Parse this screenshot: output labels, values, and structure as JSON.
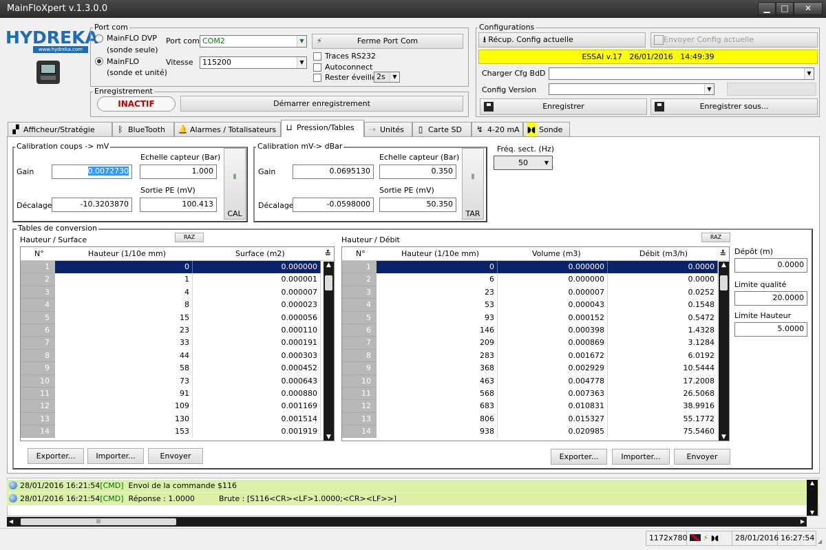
{
  "app": {
    "title": "MainFloXpert v.1.3.0.0"
  },
  "logo": {
    "brand": "HYDREKA",
    "url": "www.hydreka.com"
  },
  "portcom": {
    "legend": "Port com",
    "radio1_l1": "MainFLO DVP",
    "radio1_l2": "(sonde seule)",
    "radio2_l1": "MainFLO",
    "radio2_l2": "(sonde et unité)",
    "port_label": "Port com",
    "port_value": "COM2",
    "speed_label": "Vitesse",
    "speed_value": "115200",
    "close_btn": "Ferme Port Com",
    "traces": "Traces RS232",
    "autoconnect": "Autoconnect",
    "awake": "Rester éveillé",
    "awake_value": "2s"
  },
  "recording": {
    "legend": "Enregistrement",
    "state": "INACTIF",
    "start_btn": "Démarrer enregistrement"
  },
  "config": {
    "legend": "Configurations",
    "get_btn": "Récup. Config actuelle",
    "send_btn": "Envoyer Config actuelle",
    "banner": "ESSAI v.17   26/01/2016   14:49:39",
    "load_label": "Charger Cfg BdD",
    "version_label": "Config Version",
    "save_btn": "Enregistrer",
    "saveas_btn": "Enregistrer sous..."
  },
  "tabs": [
    "Afficheur/Stratégie",
    "BlueTooth",
    "Alarmes / Totalisateurs",
    "Pression/Tables",
    "Unités",
    "Carte SD",
    "4-20 mA",
    "Sonde"
  ],
  "cal1": {
    "legend": "Calibration coups -> mV",
    "gain_label": "Gain",
    "gain": "0.0072730",
    "offset_label": "Décalage",
    "offset": "-10.3203870",
    "scale_label": "Echelle capteur (Bar)",
    "scale": "1.000",
    "out_label": "Sortie PE (mV)",
    "out": "100.413",
    "btn": "CAL"
  },
  "cal2": {
    "legend": "Calibration mV-> dBar",
    "gain_label": "Gain",
    "gain": "0.0695130",
    "offset_label": "Décalage",
    "offset": "-0.0598000",
    "scale_label": "Echelle capteur (Bar)",
    "scale": "0.350",
    "out_label": "Sortie PE (mV)",
    "out": "50.350",
    "btn": "TAR"
  },
  "freq": {
    "label": "Fréq. sect. (Hz)",
    "value": "50"
  },
  "tables": {
    "legend": "Tables de conversion",
    "raz": "RAZ"
  },
  "surface": {
    "title": "Hauteur / Surface",
    "headers": [
      "N°",
      "Hauteur (1/10e mm)",
      "Surface (m2)"
    ],
    "rows": [
      [
        "1",
        "0",
        "0.000000"
      ],
      [
        "2",
        "1",
        "0.000001"
      ],
      [
        "3",
        "4",
        "0.000007"
      ],
      [
        "4",
        "8",
        "0.000023"
      ],
      [
        "5",
        "15",
        "0.000056"
      ],
      [
        "6",
        "23",
        "0.000110"
      ],
      [
        "7",
        "33",
        "0.000191"
      ],
      [
        "8",
        "44",
        "0.000303"
      ],
      [
        "9",
        "58",
        "0.000452"
      ],
      [
        "10",
        "73",
        "0.000643"
      ],
      [
        "11",
        "91",
        "0.000880"
      ],
      [
        "12",
        "109",
        "0.001169"
      ],
      [
        "13",
        "130",
        "0.001514"
      ],
      [
        "14",
        "153",
        "0.001919"
      ]
    ],
    "export": "Exporter...",
    "import": "Importer...",
    "send": "Envoyer"
  },
  "debit": {
    "title": "Hauteur / Débit",
    "headers": [
      "N°",
      "Hauteur (1/10e mm)",
      "Volume (m3)",
      "Débit (m3/h)"
    ],
    "rows": [
      [
        "1",
        "0",
        "0.000000",
        "0.0000"
      ],
      [
        "2",
        "6",
        "0.000000",
        "0.0000"
      ],
      [
        "3",
        "23",
        "0.000007",
        "0.0252"
      ],
      [
        "4",
        "53",
        "0.000043",
        "0.1548"
      ],
      [
        "5",
        "93",
        "0.000152",
        "0.5472"
      ],
      [
        "6",
        "146",
        "0.000398",
        "1.4328"
      ],
      [
        "7",
        "209",
        "0.000869",
        "3.1284"
      ],
      [
        "8",
        "283",
        "0.001672",
        "6.0192"
      ],
      [
        "9",
        "368",
        "0.002929",
        "10.5444"
      ],
      [
        "10",
        "463",
        "0.004778",
        "17.2008"
      ],
      [
        "11",
        "568",
        "0.007363",
        "26.5068"
      ],
      [
        "12",
        "683",
        "0.010831",
        "38.9916"
      ],
      [
        "13",
        "806",
        "0.015327",
        "55.1772"
      ],
      [
        "14",
        "938",
        "0.020985",
        "75.5460"
      ]
    ],
    "export": "Exporter...",
    "import": "Importer...",
    "send": "Envoyer"
  },
  "side": {
    "depot_label": "Dépôt (m)",
    "depot": "0.0000",
    "quality_label": "Limite qualité",
    "quality": "20.0000",
    "height_label": "Limite Hauteur",
    "height": "5.0000"
  },
  "log": [
    {
      "ts": "28/01/2016 16:21:54",
      "tag": "[CMD]",
      "msg": "Envoi de la commande $116",
      "extra": ""
    },
    {
      "ts": "28/01/2016 16:21:54",
      "tag": "[CMD]",
      "msg": "Réponse : 1.0000",
      "extra": "Brute : [S116<CR><LF>1.0000;<CR><LF>>]"
    }
  ],
  "status": {
    "resolution": "1172x780",
    "date": "28/01/2016",
    "time": "16:27:54"
  },
  "colors": {
    "banner": "#ffff00",
    "log": "#d9f2a8",
    "selection": "#0a246a",
    "inactive": "#c00000"
  }
}
